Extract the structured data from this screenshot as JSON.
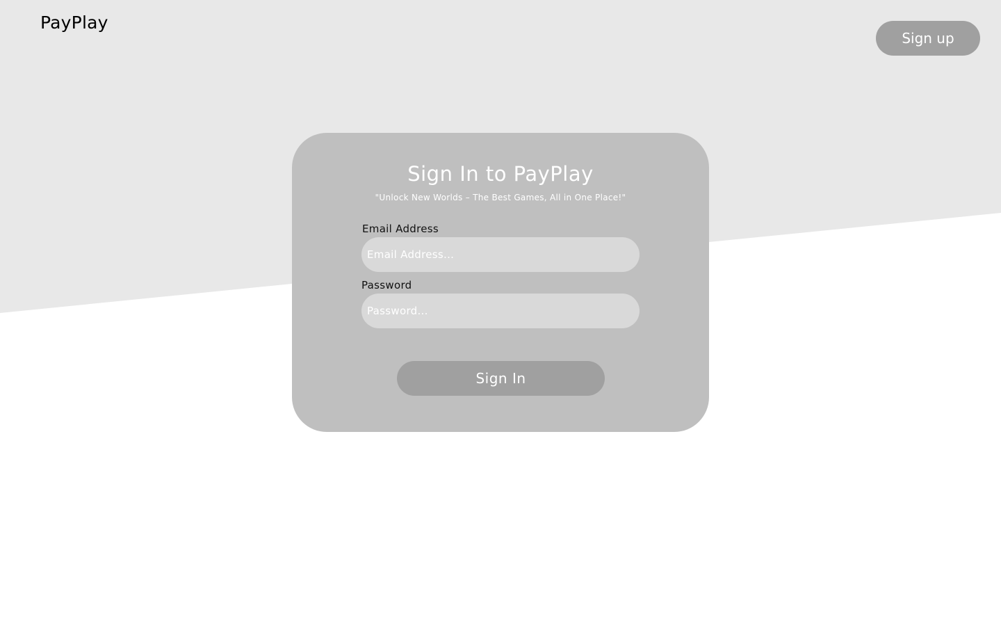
{
  "header": {
    "logo_text": "PayPlay",
    "signup_label": "Sign up"
  },
  "signin_card": {
    "title": "Sign In to PayPlay",
    "subtitle": "\"Unlock New Worlds – The Best Games, All in One Place!\"",
    "email": {
      "label": "Email Address",
      "value": "",
      "placeholder": "Email Address..."
    },
    "password": {
      "label": "Password",
      "value": "",
      "placeholder": "Password..."
    },
    "submit_label": "Sign In"
  },
  "colors": {
    "page_background": "#ffffff",
    "diagonal_band": "#e8e8e8",
    "card_background": "#bfbfbf",
    "button_background": "#a0a0a0",
    "input_background": "#d9d9d9"
  }
}
